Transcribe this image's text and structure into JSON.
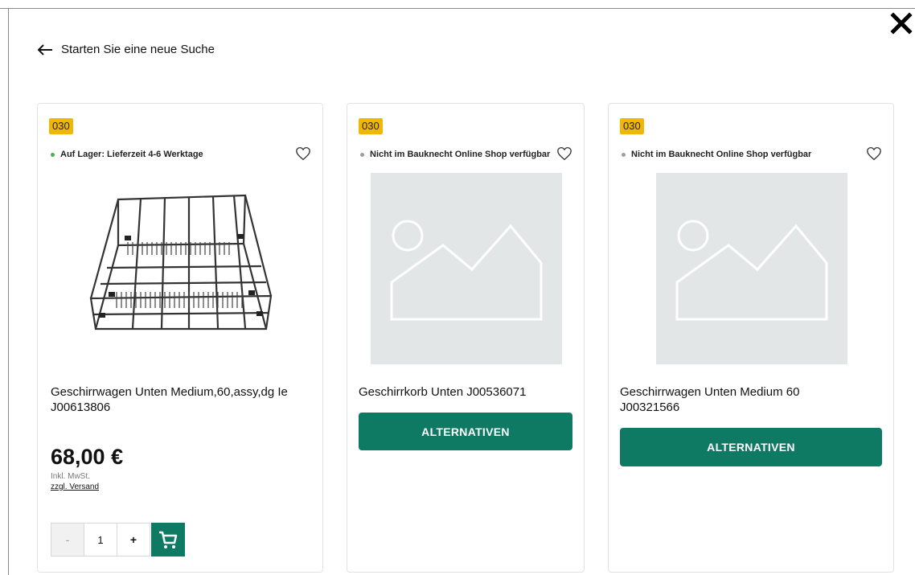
{
  "header": {
    "back_label": "Starten Sie eine neue Suche"
  },
  "colors": {
    "accent": "#0e7a64",
    "badge": "#f2b705",
    "in_stock": "#4caf50",
    "unavailable": "#9e9e9e"
  },
  "products": [
    {
      "badge": "030",
      "availability": "Auf Lager: Lieferzeit 4-6 Werktage",
      "title_line1": "Geschirrwagen Unten Medium,60,assy,dg Ie",
      "title_line2": "J00613806",
      "price": "68,00 €",
      "tax_note": "Inkl. MwSt.",
      "shipping_link": "zzgl. Versand",
      "quantity": "1",
      "qty_minus": "-",
      "qty_plus": "+"
    },
    {
      "badge": "030",
      "availability": "Nicht im Bauknecht Online Shop verfügbar",
      "title_line1": "Geschirrkorb Unten J00536071",
      "button": "ALTERNATIVEN"
    },
    {
      "badge": "030",
      "availability": "Nicht im Bauknecht Online Shop verfügbar",
      "title_line1": "Geschirrwagen Unten Medium 60",
      "title_line2": "J00321566",
      "button": "ALTERNATIVEN"
    }
  ],
  "icons": [
    "close-icon",
    "arrow-left-icon",
    "heart-icon",
    "image-placeholder-icon",
    "cart-icon"
  ]
}
